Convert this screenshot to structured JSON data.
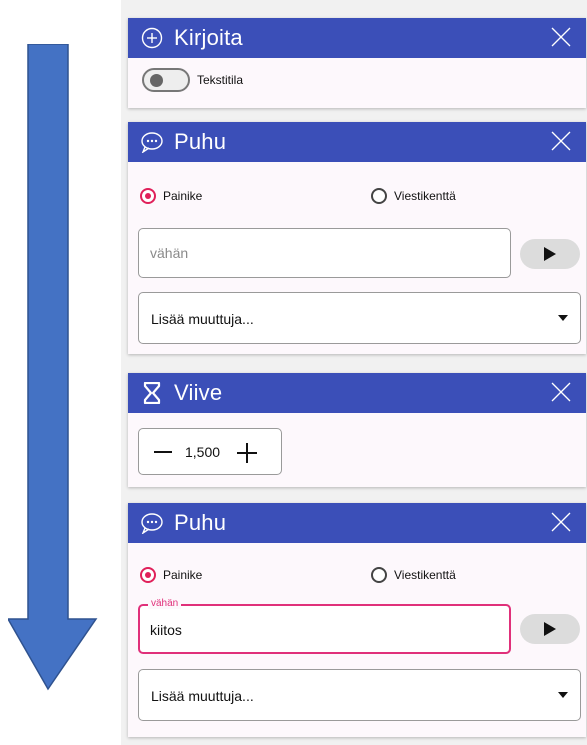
{
  "cards": {
    "write": {
      "title": "Kirjoita",
      "toggle_label": "Tekstitila"
    },
    "speak1": {
      "title": "Puhu",
      "radio_button": "Painike",
      "radio_message": "Viestikenttä",
      "field_placeholder": "vähän",
      "select_label": "Lisää muuttuja..."
    },
    "delay": {
      "title": "Viive",
      "value": "1,500"
    },
    "speak2": {
      "title": "Puhu",
      "radio_button": "Painike",
      "radio_message": "Viestikenttä",
      "field_label": "vähän",
      "field_value": "kiitos",
      "select_label": "Lisää muuttuja..."
    }
  },
  "colors": {
    "header": "#3b4fb8",
    "accent": "#e0205a",
    "arrow": "#4472c4",
    "card_bg": "#fdf8fc"
  }
}
